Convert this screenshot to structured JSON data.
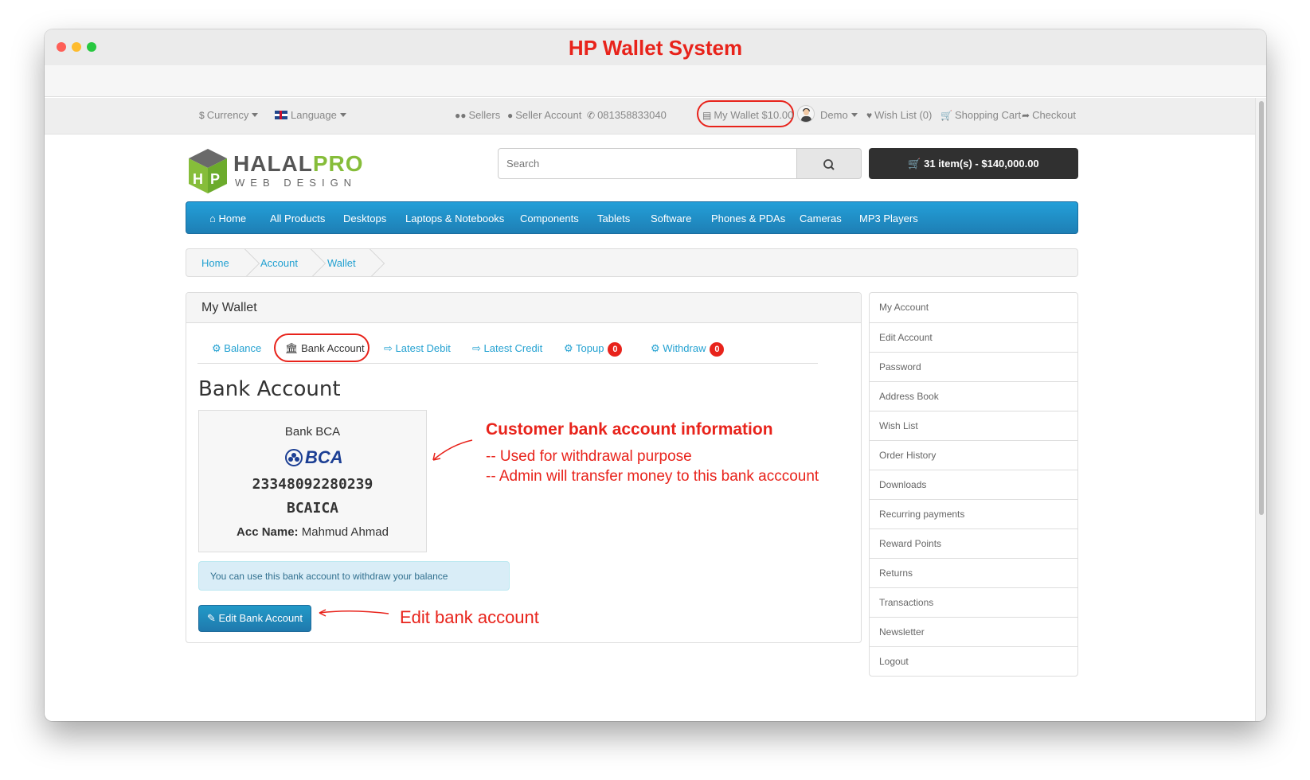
{
  "window": {
    "title": "HP Wallet System"
  },
  "topnav": {
    "currency": "Currency",
    "language": "Language",
    "sellers": "Sellers",
    "seller_account": "Seller Account",
    "phone": "081358833040",
    "wallet": "My Wallet $10.00",
    "user": "Demo",
    "wishlist": "Wish List (0)",
    "cart": "Shopping Cart",
    "checkout": "Checkout"
  },
  "logo": {
    "brand_dark": "HALAL",
    "brand_green": "PRO",
    "tagline": "WEB DESIGN"
  },
  "search": {
    "placeholder": "Search"
  },
  "cart_button": "31 item(s) - $140,000.00",
  "menu": [
    "Home",
    "All Products",
    "Desktops",
    "Laptops & Notebooks",
    "Components",
    "Tablets",
    "Software",
    "Phones & PDAs",
    "Cameras",
    "MP3 Players"
  ],
  "breadcrumb": [
    "Home",
    "Account",
    "Wallet"
  ],
  "panel": {
    "title": "My Wallet",
    "tabs": [
      {
        "label": "Balance"
      },
      {
        "label": "Bank Account"
      },
      {
        "label": "Latest Debit"
      },
      {
        "label": "Latest Credit"
      },
      {
        "label": "Topup",
        "badge": "0"
      },
      {
        "label": "Withdraw",
        "badge": "0"
      }
    ],
    "heading": "Bank Account",
    "bank": {
      "name": "Bank BCA",
      "logo_text": "BCA",
      "number": "23348092280239",
      "code": "BCAICA",
      "acc_label": "Acc Name:",
      "acc_name": "Mahmud Ahmad"
    },
    "info": "You can use this bank account to withdraw your balance",
    "edit_button": "Edit Bank Account"
  },
  "annotations": {
    "title": "Customer bank account information",
    "line1": "-- Used for withdrawal purpose",
    "line2": "-- Admin will transfer money to this bank acccount",
    "edit": "Edit bank account"
  },
  "sidebar": [
    "My Account",
    "Edit Account",
    "Password",
    "Address Book",
    "Wish List",
    "Order History",
    "Downloads",
    "Recurring payments",
    "Reward Points",
    "Returns",
    "Transactions",
    "Newsletter",
    "Logout"
  ],
  "colors": {
    "accent_blue": "#23a1d1",
    "annotation_red": "#e8231b",
    "logo_green": "#86bd3a"
  }
}
